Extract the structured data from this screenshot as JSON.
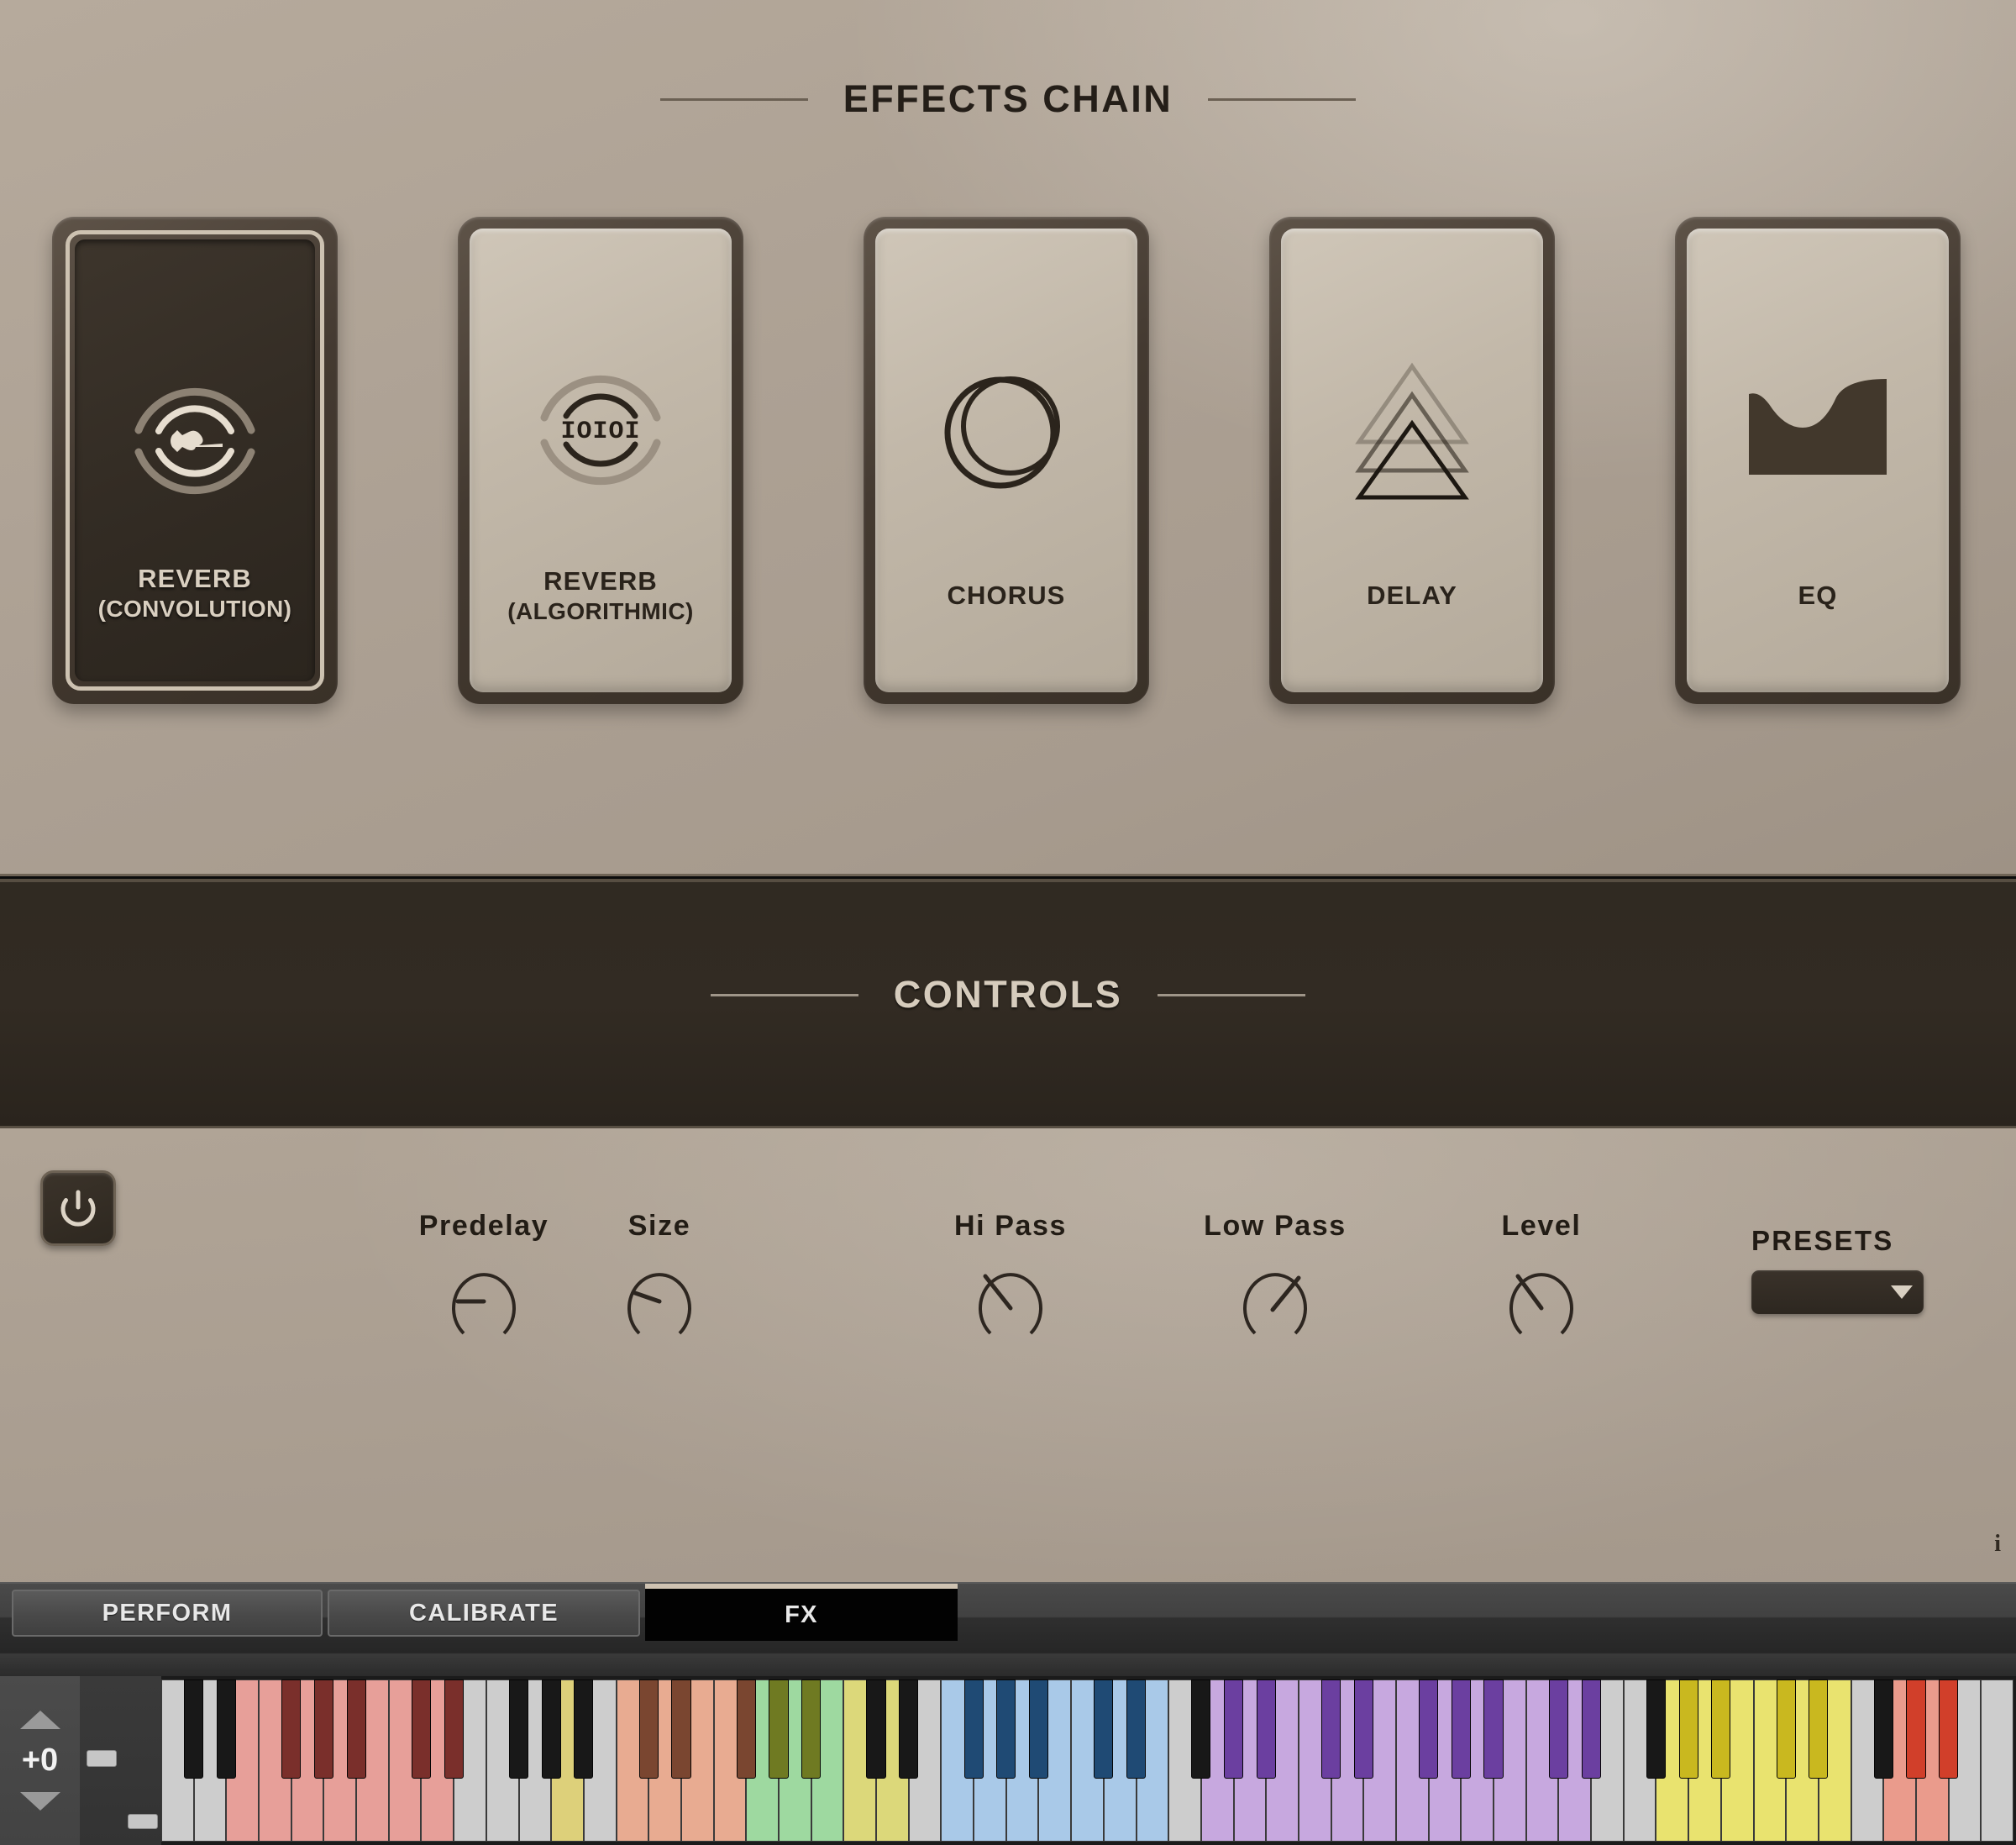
{
  "effects_section": {
    "title": "EFFECTS CHAIN",
    "slots": [
      {
        "name": "REVERB",
        "sub": "(CONVOLUTION)",
        "icon": "reverb-convolution-icon",
        "active": true
      },
      {
        "name": "REVERB",
        "sub": "(ALGORITHMIC)",
        "icon": "reverb-algorithmic-icon",
        "active": false,
        "icon_text": "IOIOI"
      },
      {
        "name": "CHORUS",
        "sub": "",
        "icon": "chorus-rings-icon",
        "active": false
      },
      {
        "name": "DELAY",
        "sub": "",
        "icon": "delay-triangles-icon",
        "active": false
      },
      {
        "name": "EQ",
        "sub": "",
        "icon": "eq-curve-icon",
        "active": false
      }
    ]
  },
  "controls_section": {
    "title": "CONTROLS",
    "power": {
      "name": "power-toggle",
      "state": "on",
      "icon": "power-icon"
    },
    "knobs": [
      {
        "label": "Predelay",
        "value_angle": -135,
        "value_pct": 0
      },
      {
        "label": "Size",
        "value_angle": -110,
        "value_pct": 9
      },
      {
        "label": "Hi Pass",
        "value_angle": -48,
        "value_pct": 32
      },
      {
        "label": "Low Pass",
        "value_angle": 48,
        "value_pct": 68
      },
      {
        "label": "Level",
        "value_angle": -40,
        "value_pct": 35
      }
    ],
    "presets": {
      "label": "PRESETS",
      "value": "",
      "arrow_icon": "chevron-down-icon"
    },
    "info_badge": "i"
  },
  "tabs": [
    {
      "label": "PERFORM",
      "active": false
    },
    {
      "label": "CALIBRATE",
      "active": false
    },
    {
      "label": "FX",
      "active": true
    }
  ],
  "keyboard": {
    "octave_control": {
      "value": "+0",
      "up_icon": "triangle-up-icon",
      "down_icon": "triangle-down-icon"
    },
    "zones": [
      {
        "color": "#cdcdcd",
        "black": "#181818",
        "keys": 2
      },
      {
        "color": "#e79f99",
        "black": "#7a2f2b",
        "keys": 7
      },
      {
        "color": "#cdcdcd",
        "black": "#181818",
        "keys": 3
      },
      {
        "color": "#ddd07a",
        "black": "#181818",
        "keys": 1
      },
      {
        "color": "#cdcdcd",
        "black": "#181818",
        "keys": 1
      },
      {
        "color": "#e8ab91",
        "black": "#7a4630",
        "keys": 4
      },
      {
        "color": "#9ed9a0",
        "black": "#6f7a22",
        "keys": 3
      },
      {
        "color": "#dcd87a",
        "black": "#181818",
        "keys": 2
      },
      {
        "color": "#cdcdcd",
        "black": "#181818",
        "keys": 1
      },
      {
        "color": "#a9c9e8",
        "black": "#1f4a74",
        "keys": 7
      },
      {
        "color": "#cdcdcd",
        "black": "#181818",
        "keys": 1
      },
      {
        "color": "#c7a8df",
        "black": "#6b3fa0",
        "keys": 12
      },
      {
        "color": "#cdcdcd",
        "black": "#181818",
        "keys": 2
      },
      {
        "color": "#e9e36f",
        "black": "#c9b81f",
        "keys": 6
      },
      {
        "color": "#cdcdcd",
        "black": "#181818",
        "keys": 1
      },
      {
        "color": "#ea9b8c",
        "black": "#d13f2a",
        "keys": 2
      },
      {
        "color": "#cdcdcd",
        "black": "#181818",
        "keys": 2
      }
    ],
    "scroll_handles": [
      {
        "name": "keyboard-range-handle-upper"
      },
      {
        "name": "keyboard-range-handle-lower"
      }
    ]
  },
  "colors": {
    "panel_bg": "#ada194",
    "dark_band": "#302a22",
    "slot_frame": "#443a31",
    "active_slot_bg": "#332c24",
    "accent_cream": "#cfc3b2",
    "text_dark": "#241e18"
  }
}
